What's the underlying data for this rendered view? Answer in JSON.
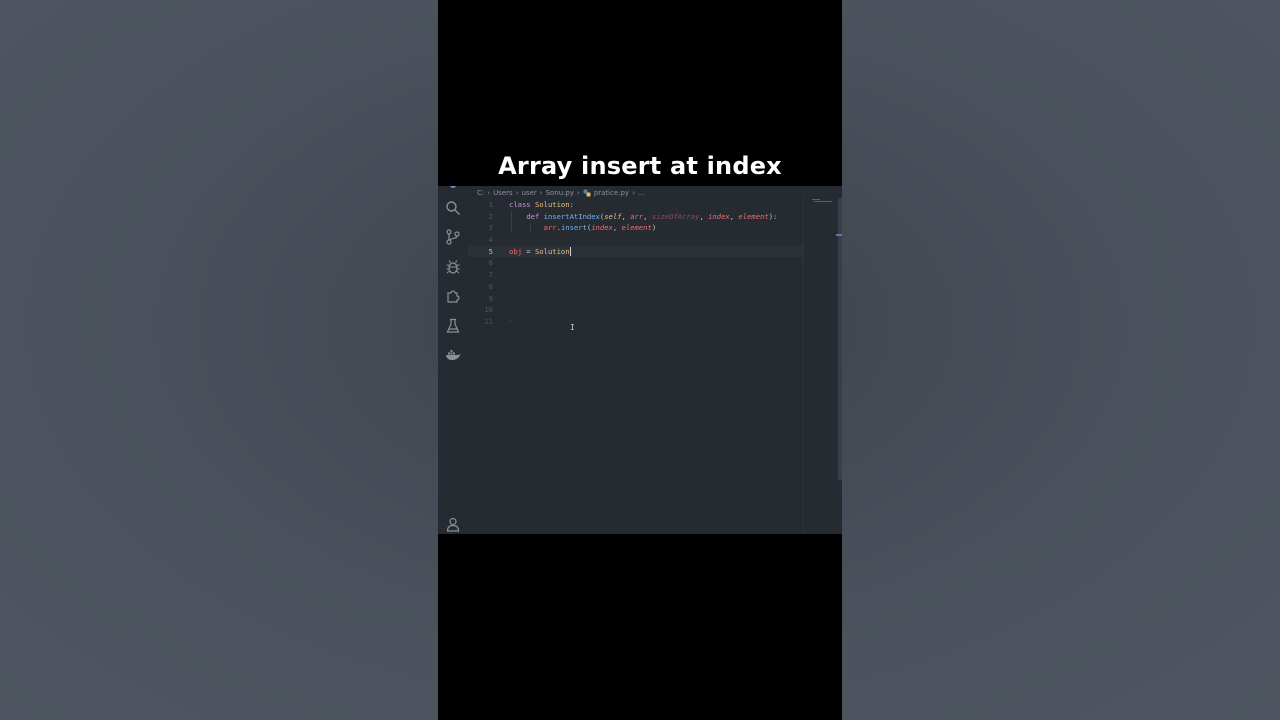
{
  "video": {
    "title": "Array insert at index"
  },
  "activity_bar": {
    "items": [
      {
        "name": "search-icon"
      },
      {
        "name": "source-control-icon"
      },
      {
        "name": "debug-icon"
      },
      {
        "name": "extensions-icon"
      },
      {
        "name": "testing-icon"
      },
      {
        "name": "docker-icon"
      }
    ],
    "bottom": {
      "name": "account-icon"
    }
  },
  "breadcrumb": {
    "parts": [
      "C:",
      "Users",
      "user",
      "Sonu.py",
      "pratice.py",
      "..."
    ]
  },
  "editor": {
    "active_line": 5,
    "line_numbers": [
      "1",
      "2",
      "3",
      "4",
      "5",
      "6",
      "7",
      "8",
      "9",
      "10",
      "11"
    ],
    "lines": [
      {
        "n": "1",
        "tokens": [
          [
            "kw",
            "class"
          ],
          [
            "punc",
            " "
          ],
          [
            "cls",
            "Solution"
          ],
          [
            "punc",
            ":"
          ]
        ]
      },
      {
        "n": "2",
        "tokens": [
          [
            "punc",
            "    "
          ],
          [
            "kw",
            "def"
          ],
          [
            "punc",
            " "
          ],
          [
            "fn",
            "insertAtIndex"
          ],
          [
            "punc",
            "("
          ],
          [
            "self",
            "self"
          ],
          [
            "punc",
            ", "
          ],
          [
            "param",
            "arr"
          ],
          [
            "punc",
            ", "
          ],
          [
            "param-dim",
            "sizeOfArray"
          ],
          [
            "punc",
            ", "
          ],
          [
            "param",
            "index"
          ],
          [
            "punc",
            ", "
          ],
          [
            "param",
            "element"
          ],
          [
            "punc",
            "):"
          ]
        ]
      },
      {
        "n": "3",
        "tokens": [
          [
            "punc",
            "        "
          ],
          [
            "var",
            "arr"
          ],
          [
            "punc",
            "."
          ],
          [
            "fn",
            "insert"
          ],
          [
            "punc",
            "("
          ],
          [
            "param",
            "index"
          ],
          [
            "punc",
            ", "
          ],
          [
            "param",
            "element"
          ],
          [
            "punc",
            ")"
          ]
        ]
      },
      {
        "n": "4",
        "tokens": []
      },
      {
        "n": "5",
        "tokens": [
          [
            "var",
            "obj"
          ],
          [
            "punc",
            " = "
          ],
          [
            "cls",
            "Solution"
          ]
        ]
      },
      {
        "n": "6",
        "tokens": []
      },
      {
        "n": "7",
        "tokens": []
      },
      {
        "n": "8",
        "tokens": []
      },
      {
        "n": "9",
        "tokens": []
      },
      {
        "n": "10",
        "tokens": []
      },
      {
        "n": "11",
        "tokens": []
      }
    ]
  },
  "colors": {
    "editor_bg": "#262a31",
    "keyword": "#d38cf0",
    "class": "#e8c27c",
    "function": "#6fb3f2",
    "parameter": "#ef6b73"
  }
}
